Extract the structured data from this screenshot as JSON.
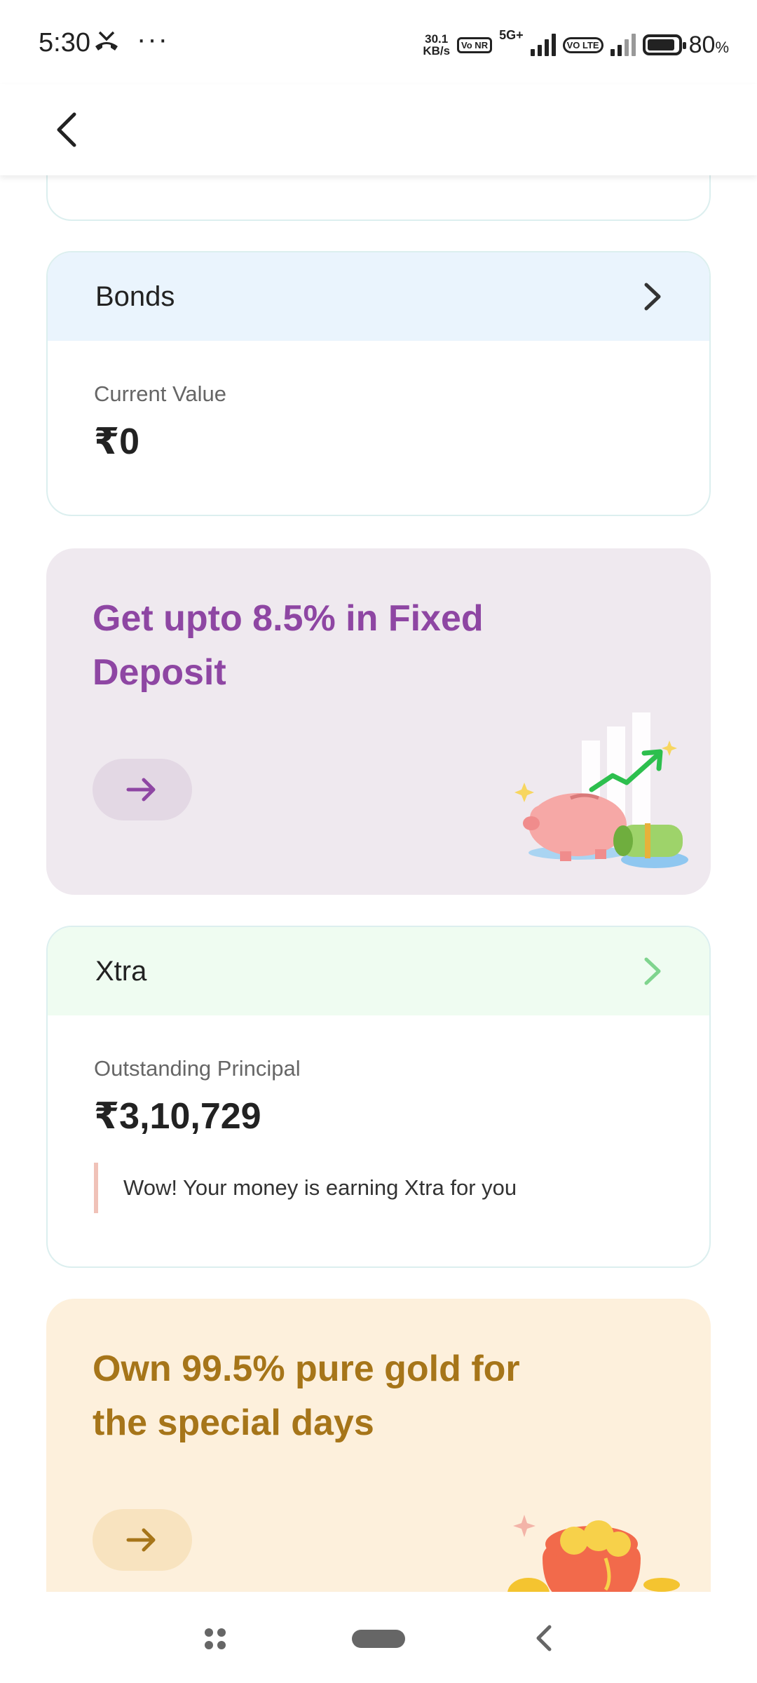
{
  "status_bar": {
    "time": "5:30",
    "overflow": "···",
    "net_speed_value": "30.1",
    "net_speed_unit": "KB/s",
    "vonr_tag": "Vo NR",
    "five_g": "5G+",
    "volte_tag": "VO LTE",
    "battery_percent": "80",
    "battery_level": 0.8
  },
  "header": {
    "back_icon": "chevron-left-icon"
  },
  "bonds": {
    "title": "Bonds",
    "label": "Current Value",
    "value": "₹0"
  },
  "fd_promo": {
    "title": "Get upto 8.5% in Fixed Deposit",
    "accent": "#8e46a3"
  },
  "xtra": {
    "title": "Xtra",
    "label": "Outstanding Principal",
    "value": "₹3,10,729",
    "note": "Wow! Your money is earning Xtra for you"
  },
  "gold_promo": {
    "title": "Own 99.5% pure gold for the special days",
    "accent": "#a67519"
  },
  "nav": {
    "apps_icon": "apps-icon",
    "home_icon": "home-pill-icon",
    "back_icon": "back-icon"
  }
}
